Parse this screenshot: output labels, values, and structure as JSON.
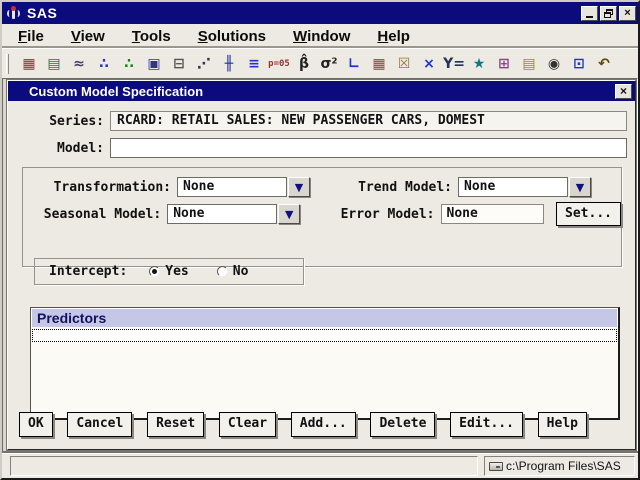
{
  "theme": {
    "titlebar_color": "#0b0b7e",
    "window_bg": "#EDEAE3",
    "list_header_bg": "#C6C6E6",
    "list_header_text": "#12125E",
    "list_bg": "#FBFAF5",
    "accent_navy": "#101080"
  },
  "window": {
    "title": "SAS",
    "controls": [
      "minimize",
      "restore",
      "close"
    ]
  },
  "menu": {
    "items": [
      {
        "label": "File"
      },
      {
        "label": "View"
      },
      {
        "label": "Tools"
      },
      {
        "label": "Solutions"
      },
      {
        "label": "Window"
      },
      {
        "label": "Help"
      }
    ]
  },
  "toolbar": {
    "icons": [
      {
        "name": "series-calendar-icon",
        "glyph": "▦",
        "color": "#8a3333"
      },
      {
        "name": "project-list-icon",
        "glyph": "▤",
        "color": "#336a33"
      },
      {
        "name": "line-plot-icon",
        "glyph": "≈",
        "color": "#44406a"
      },
      {
        "name": "develop-models-icon",
        "glyph": "∴",
        "color": "#2233bb"
      },
      {
        "name": "fit-models-icon",
        "glyph": "∴",
        "color": "#118811"
      },
      {
        "name": "produce-forecasts-icon",
        "glyph": "▣",
        "color": "#333388"
      },
      {
        "name": "import-data-icon",
        "glyph": "⊟",
        "color": "#555555"
      },
      {
        "name": "scatter-plot-icon",
        "glyph": "⋰",
        "color": "#333355"
      },
      {
        "name": "spike-plot-icon",
        "glyph": "╫",
        "color": "#223399"
      },
      {
        "name": "filter-icon",
        "glyph": "≡",
        "color": "#2233cc"
      },
      {
        "name": "p-value-icon",
        "glyph": "p=05",
        "color": "#993333"
      },
      {
        "name": "beta-estimate-icon",
        "glyph": "β̂",
        "color": "#222222"
      },
      {
        "name": "sigma-squared-icon",
        "glyph": "σ²",
        "color": "#222222"
      },
      {
        "name": "curve-plot-icon",
        "glyph": "∟",
        "color": "#2233cc"
      },
      {
        "name": "data-table-icon",
        "glyph": "▦",
        "color": "#884444"
      },
      {
        "name": "erase-icon",
        "glyph": "☒",
        "color": "#997733"
      },
      {
        "name": "delete-x-icon",
        "glyph": "×",
        "color": "#2233cc"
      },
      {
        "name": "fit-equation-icon",
        "glyph": "Y=",
        "color": "#223355"
      },
      {
        "name": "forecast-wizard-icon",
        "glyph": "★",
        "color": "#117788"
      },
      {
        "name": "copy-documents-icon",
        "glyph": "⊞",
        "color": "#884488"
      },
      {
        "name": "preview-document-icon",
        "glyph": "▤",
        "color": "#998822"
      },
      {
        "name": "graphics-device-icon",
        "glyph": "◉",
        "color": "#333333"
      },
      {
        "name": "copy-window-icon",
        "glyph": "⊡",
        "color": "#2233cc"
      },
      {
        "name": "undo-icon",
        "glyph": "↶",
        "color": "#5a4a00"
      }
    ]
  },
  "dialog": {
    "title": "Custom Model Specification",
    "series": {
      "label": "Series:",
      "value": "RCARD: RETAIL SALES: NEW PASSENGER CARS, DOMEST"
    },
    "model": {
      "label": "Model:",
      "value": ""
    },
    "transformation": {
      "label": "Transformation:",
      "value": "None"
    },
    "trend_model": {
      "label": "Trend Model:",
      "value": "None"
    },
    "seasonal_model": {
      "label": "Seasonal Model:",
      "value": "None"
    },
    "error_model": {
      "label": "Error Model:",
      "value": "None",
      "set_button_label": "Set..."
    },
    "intercept": {
      "label": "Intercept:",
      "options": [
        {
          "label": "Yes",
          "selected": true
        },
        {
          "label": "No",
          "selected": false
        }
      ]
    },
    "predictors": {
      "header": "Predictors",
      "rows": []
    },
    "buttons": [
      {
        "label": "OK"
      },
      {
        "label": "Cancel"
      },
      {
        "label": "Reset"
      },
      {
        "label": "Clear"
      },
      {
        "label": "Add..."
      },
      {
        "label": "Delete"
      },
      {
        "label": "Edit..."
      },
      {
        "label": "Help"
      }
    ]
  },
  "statusbar": {
    "path": "c:\\Program Files\\SAS"
  }
}
